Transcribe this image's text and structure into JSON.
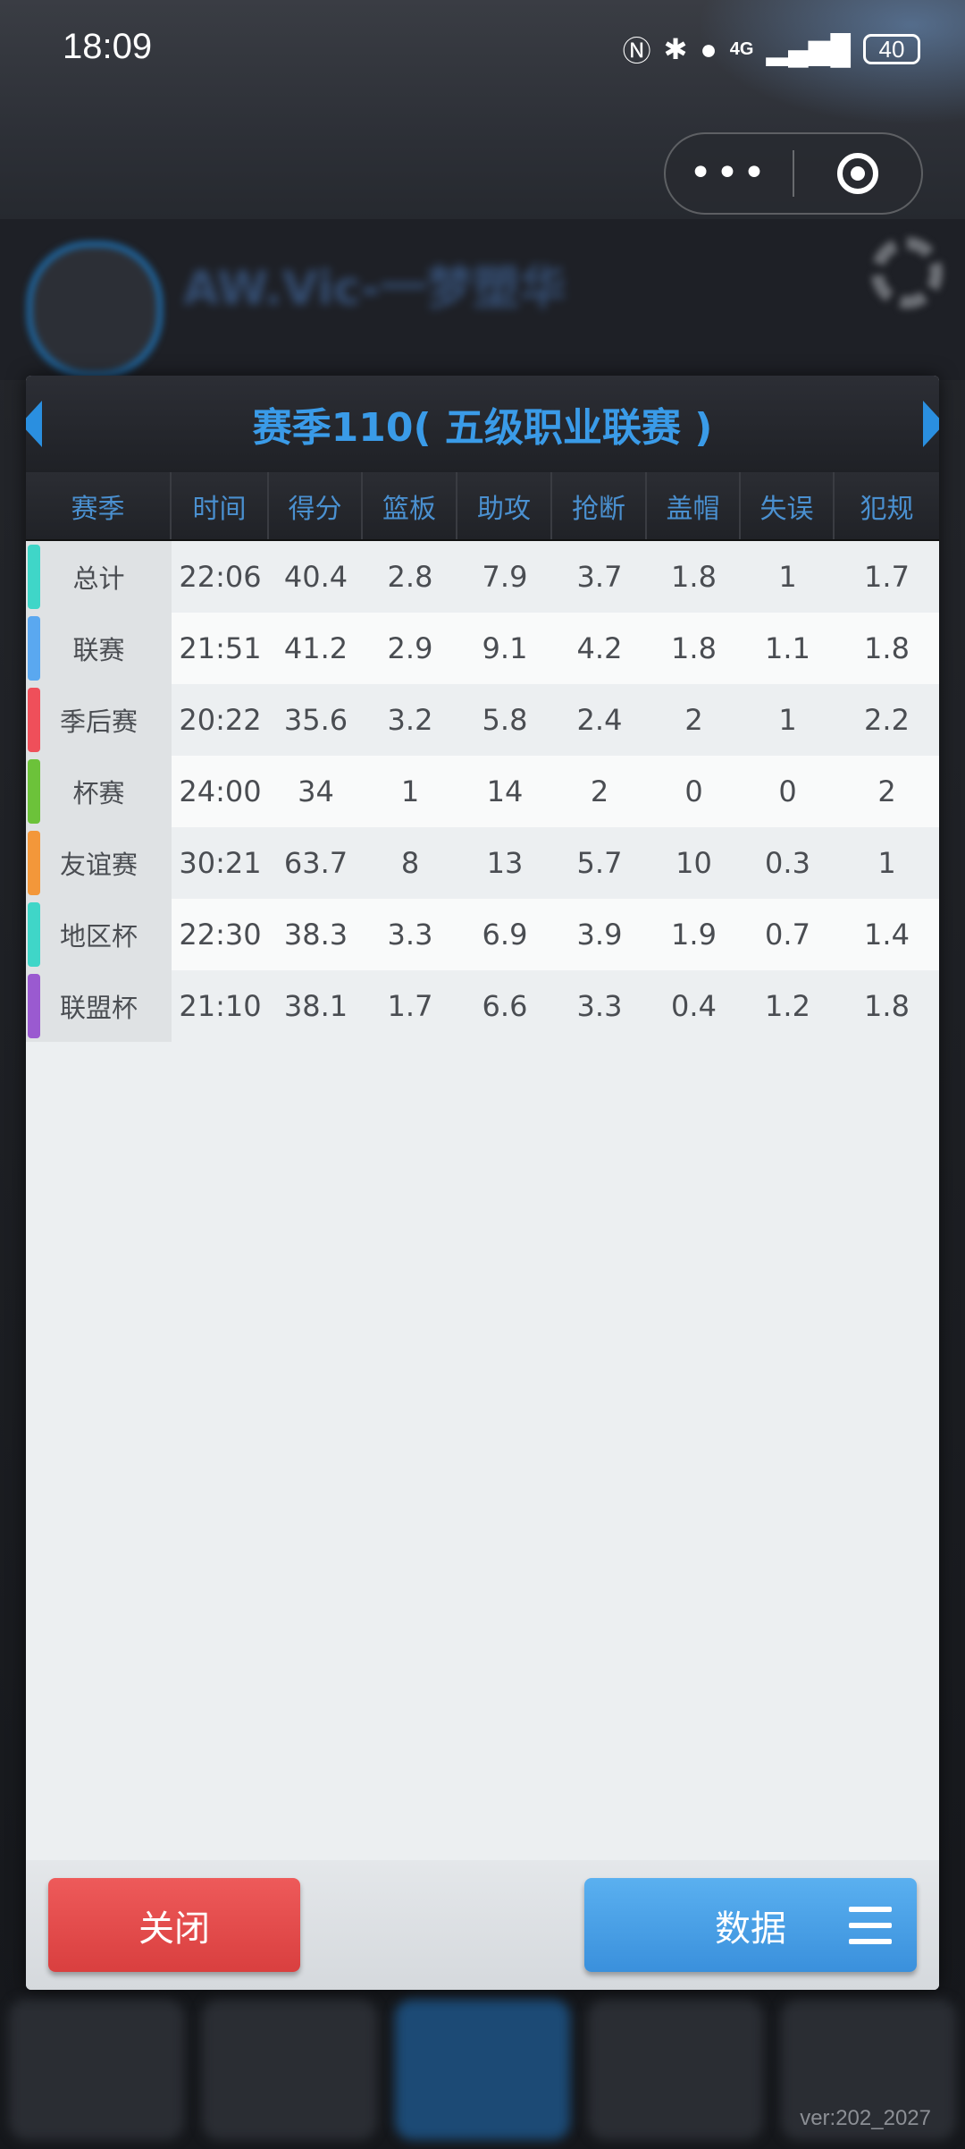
{
  "status_bar": {
    "time": "18:09",
    "network": "4G",
    "battery": "40"
  },
  "capsule": {
    "more_label": "•••"
  },
  "background": {
    "player_name": "AW.Vic-一梦塑华",
    "version": "ver:202_2027"
  },
  "dialog": {
    "title": "赛季110( 五级职业联赛 )",
    "headers": [
      "赛季",
      "时间",
      "得分",
      "篮板",
      "助攻",
      "抢断",
      "盖帽",
      "失误",
      "犯规"
    ],
    "rows": [
      {
        "name": "总计",
        "color": "#3fd6c8",
        "values": [
          "22:06",
          "40.4",
          "2.8",
          "7.9",
          "3.7",
          "1.8",
          "1",
          "1.7"
        ]
      },
      {
        "name": "联赛",
        "color": "#5aa8f0",
        "values": [
          "21:51",
          "41.2",
          "2.9",
          "9.1",
          "4.2",
          "1.8",
          "1.1",
          "1.8"
        ]
      },
      {
        "name": "季后赛",
        "color": "#ef4f5a",
        "values": [
          "20:22",
          "35.6",
          "3.2",
          "5.8",
          "2.4",
          "2",
          "1",
          "2.2"
        ]
      },
      {
        "name": "杯赛",
        "color": "#6cc23a",
        "values": [
          "24:00",
          "34",
          "1",
          "14",
          "2",
          "0",
          "0",
          "2"
        ]
      },
      {
        "name": "友谊赛",
        "color": "#f3973a",
        "values": [
          "30:21",
          "63.7",
          "8",
          "13",
          "5.7",
          "10",
          "0.3",
          "1"
        ]
      },
      {
        "name": "地区杯",
        "color": "#3fd6c8",
        "values": [
          "22:30",
          "38.3",
          "3.3",
          "6.9",
          "3.9",
          "1.9",
          "0.7",
          "1.4"
        ]
      },
      {
        "name": "联盟杯",
        "color": "#9a5ad0",
        "values": [
          "21:10",
          "38.1",
          "1.7",
          "6.6",
          "3.3",
          "0.4",
          "1.2",
          "1.8"
        ]
      }
    ],
    "close_label": "关闭",
    "data_label": "数据"
  }
}
